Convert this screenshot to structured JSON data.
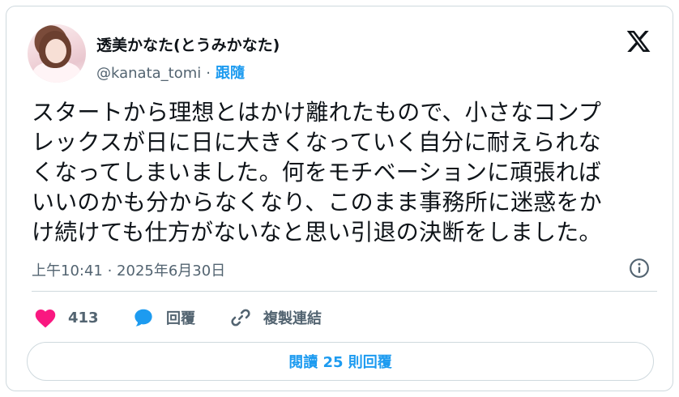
{
  "author": {
    "display_name": "透美かなた(とうみかなた)",
    "handle": "@kanata_tomi",
    "separator": "·",
    "follow_label": "跟隨"
  },
  "tweet": {
    "text": "スタートから理想とはかけ離れたもので、小さなコンプ\nレックスが日に日に大きくなっていく自分に耐えられな\nくなってしまいました。何をモチベーションに頑張れば\nいいのかも分からなくなり、このまま事務所に迷惑をか\nけ続けても仕方がないなと思い引退の決断をしました。",
    "timestamp": "上午10:41 · 2025年6月30日"
  },
  "actions": {
    "like_count": "413",
    "reply_label": "回覆",
    "copy_link_label": "複製連結"
  },
  "read_replies_label": "閱讀 25 則回覆",
  "colors": {
    "accent": "#1d9bf0",
    "like": "#f91880",
    "secondary_text": "#536471",
    "border": "#cfd9de"
  },
  "icons": {
    "logo": "x-logo-icon",
    "info": "info-icon",
    "like": "heart-icon",
    "reply": "speech-bubble-icon",
    "copy": "link-icon"
  }
}
